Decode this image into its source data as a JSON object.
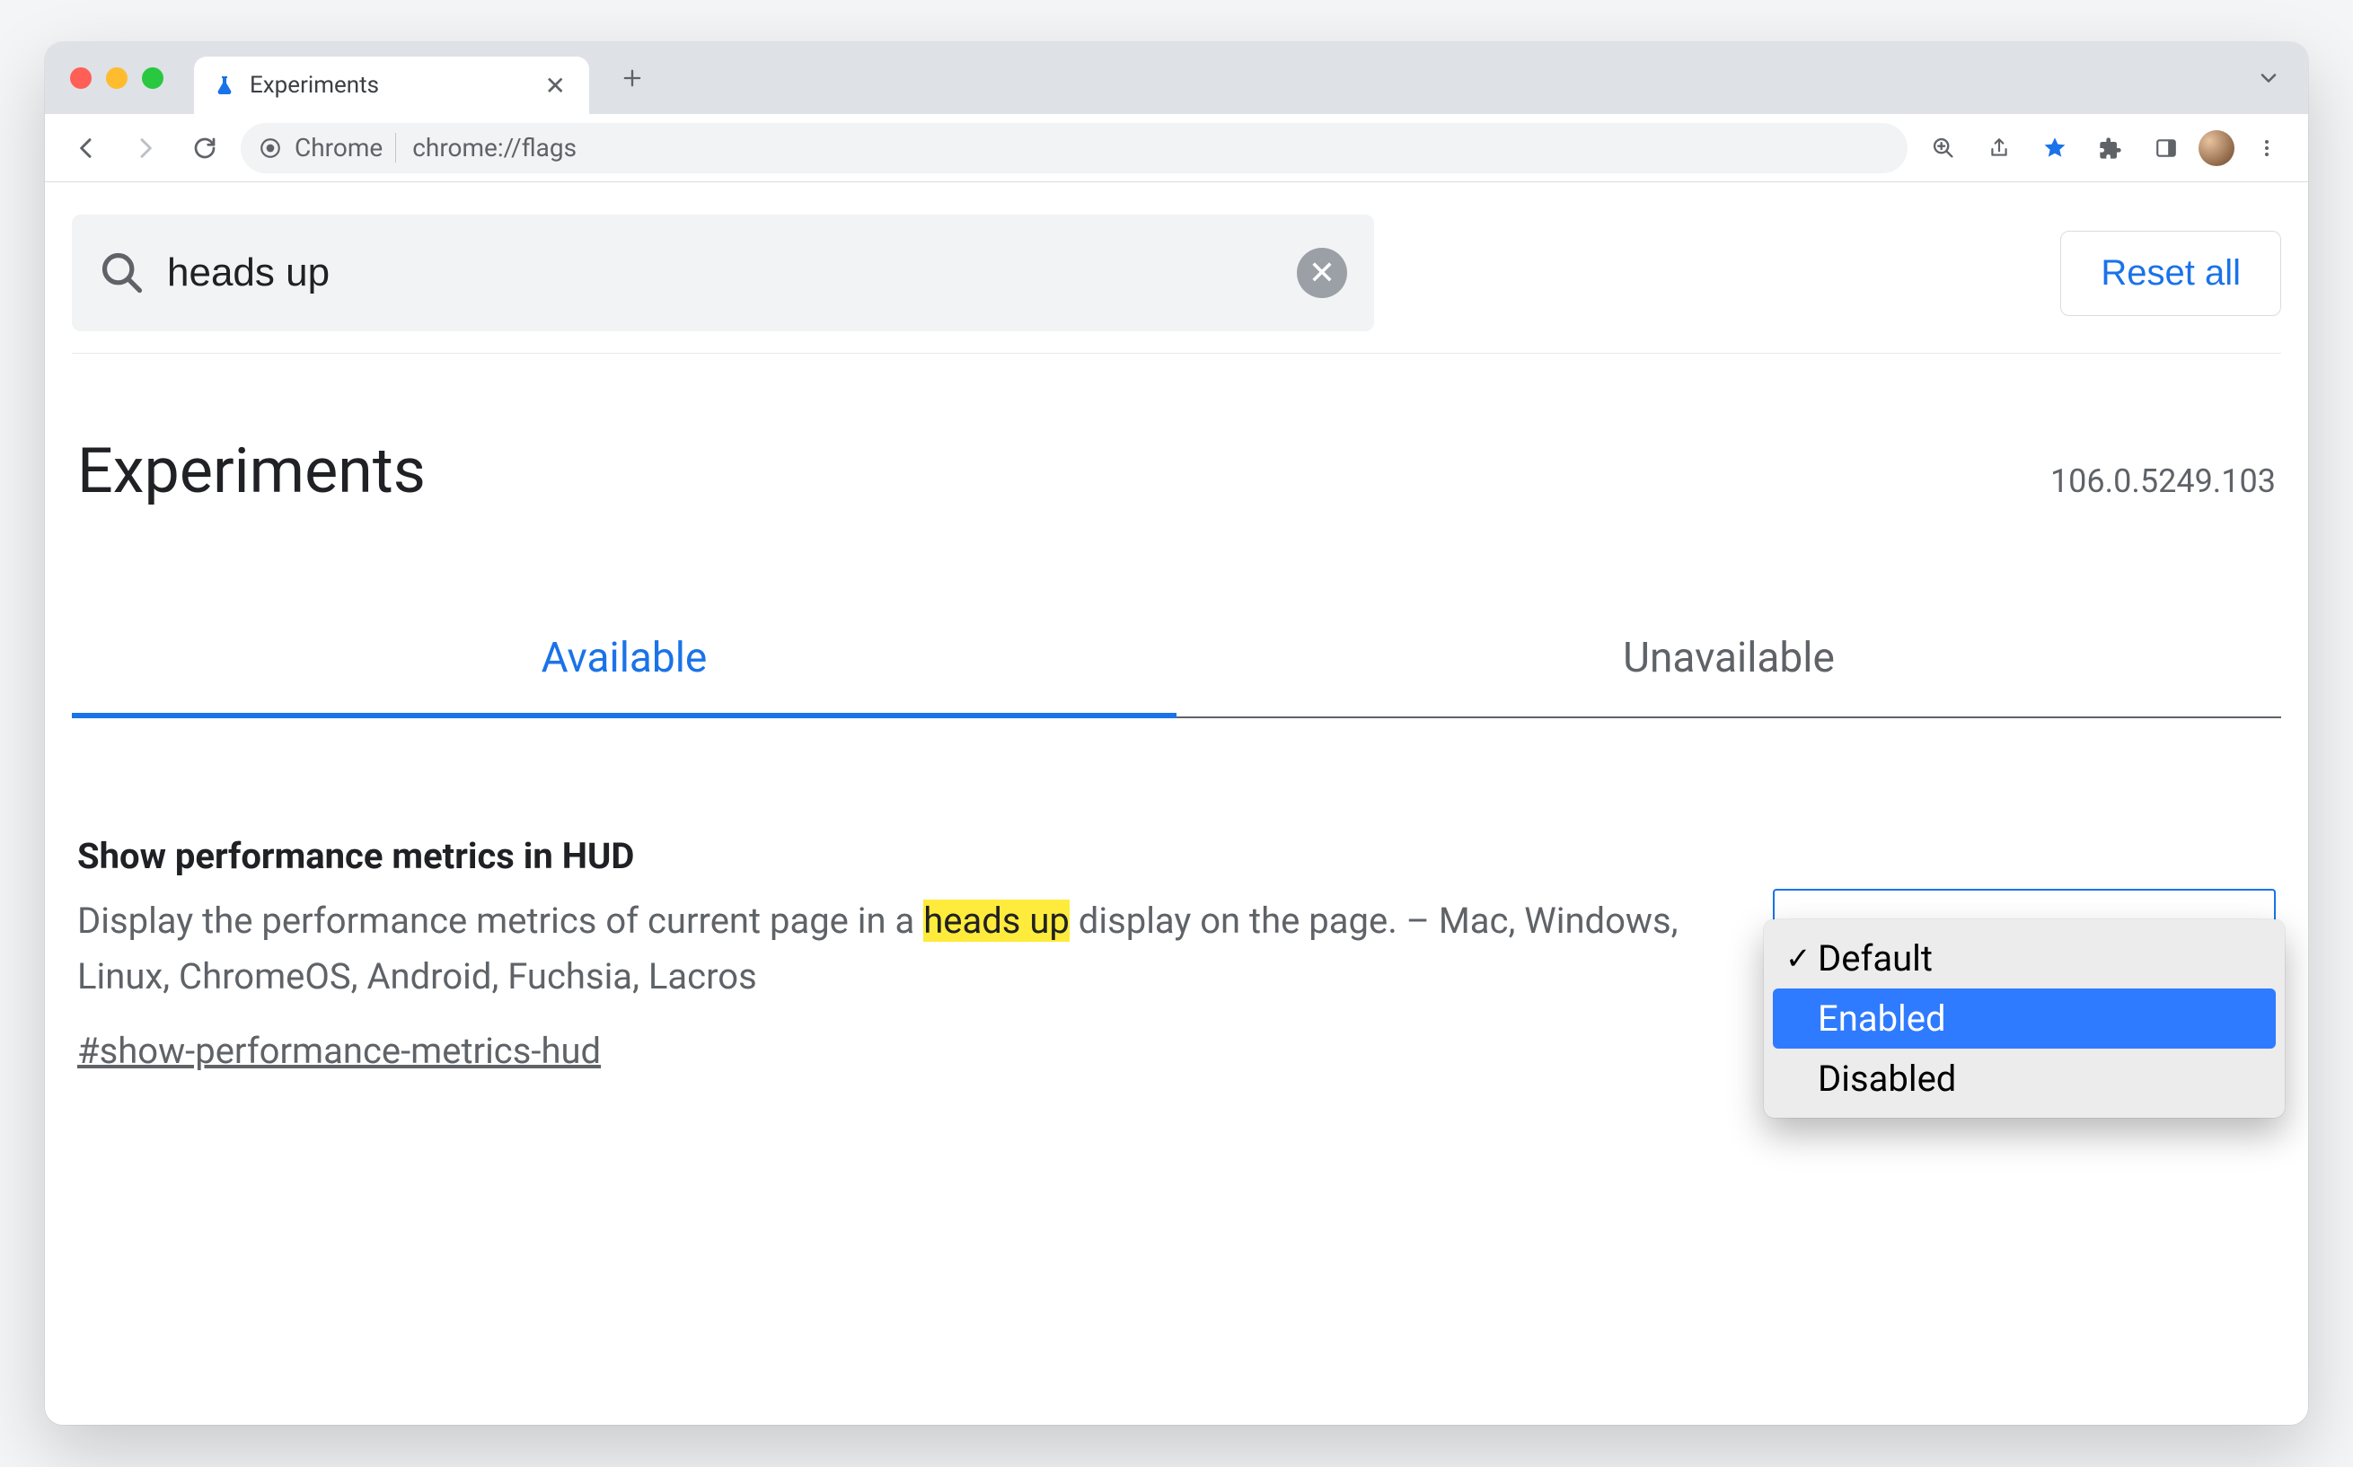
{
  "window": {
    "tab_title": "Experiments",
    "omnibox_chip": "Chrome",
    "omnibox_url": "chrome://flags"
  },
  "search": {
    "query": "heads up",
    "reset_label": "Reset all"
  },
  "header": {
    "title": "Experiments",
    "version": "106.0.5249.103"
  },
  "tabs": {
    "available": "Available",
    "unavailable": "Unavailable"
  },
  "flag": {
    "title": "Show performance metrics in HUD",
    "desc_before": "Display the performance metrics of current page in a ",
    "desc_highlight": "heads up",
    "desc_after": " display on the page. – Mac, Windows, Linux, ChromeOS, Android, Fuchsia, Lacros",
    "anchor": "#show-performance-metrics-hud",
    "options": {
      "default": "Default",
      "enabled": "Enabled",
      "disabled": "Disabled"
    }
  }
}
